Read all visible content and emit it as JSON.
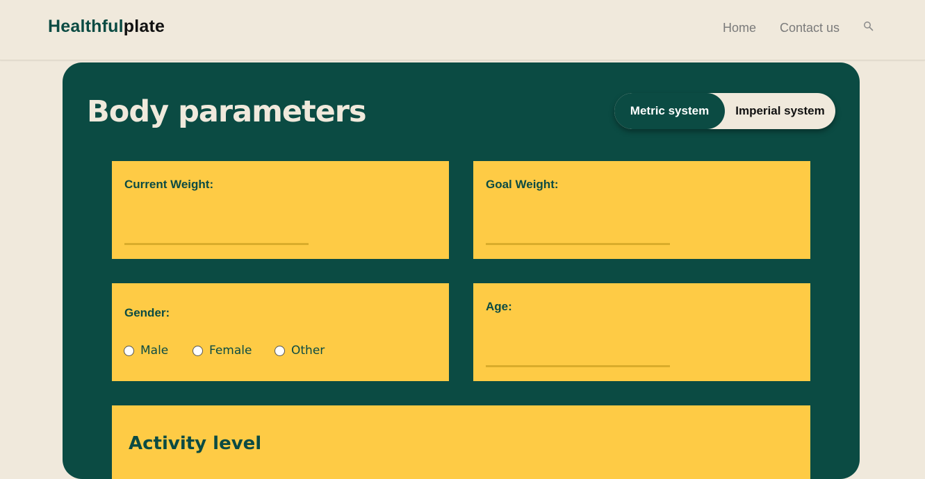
{
  "header": {
    "logo_part1": "Healthful",
    "logo_part2": "plate",
    "nav": {
      "home": "Home",
      "contact": "Contact us"
    }
  },
  "panel": {
    "title": "Body parameters",
    "units": {
      "metric": "Metric system",
      "imperial": "Imperial system",
      "selected": "metric"
    },
    "current_weight": {
      "label": "Current Weight:",
      "value": ""
    },
    "goal_weight": {
      "label": "Goal Weight:",
      "value": ""
    },
    "gender": {
      "label": "Gender:",
      "options": [
        "Male",
        "Female",
        "Other"
      ]
    },
    "age": {
      "label": "Age:",
      "value": ""
    },
    "activity": {
      "label": "Activity level"
    }
  },
  "colors": {
    "background": "#f0e9dc",
    "primary": "#0b4b43",
    "card": "#fecb45",
    "input_underline": "#d9ac2b"
  }
}
